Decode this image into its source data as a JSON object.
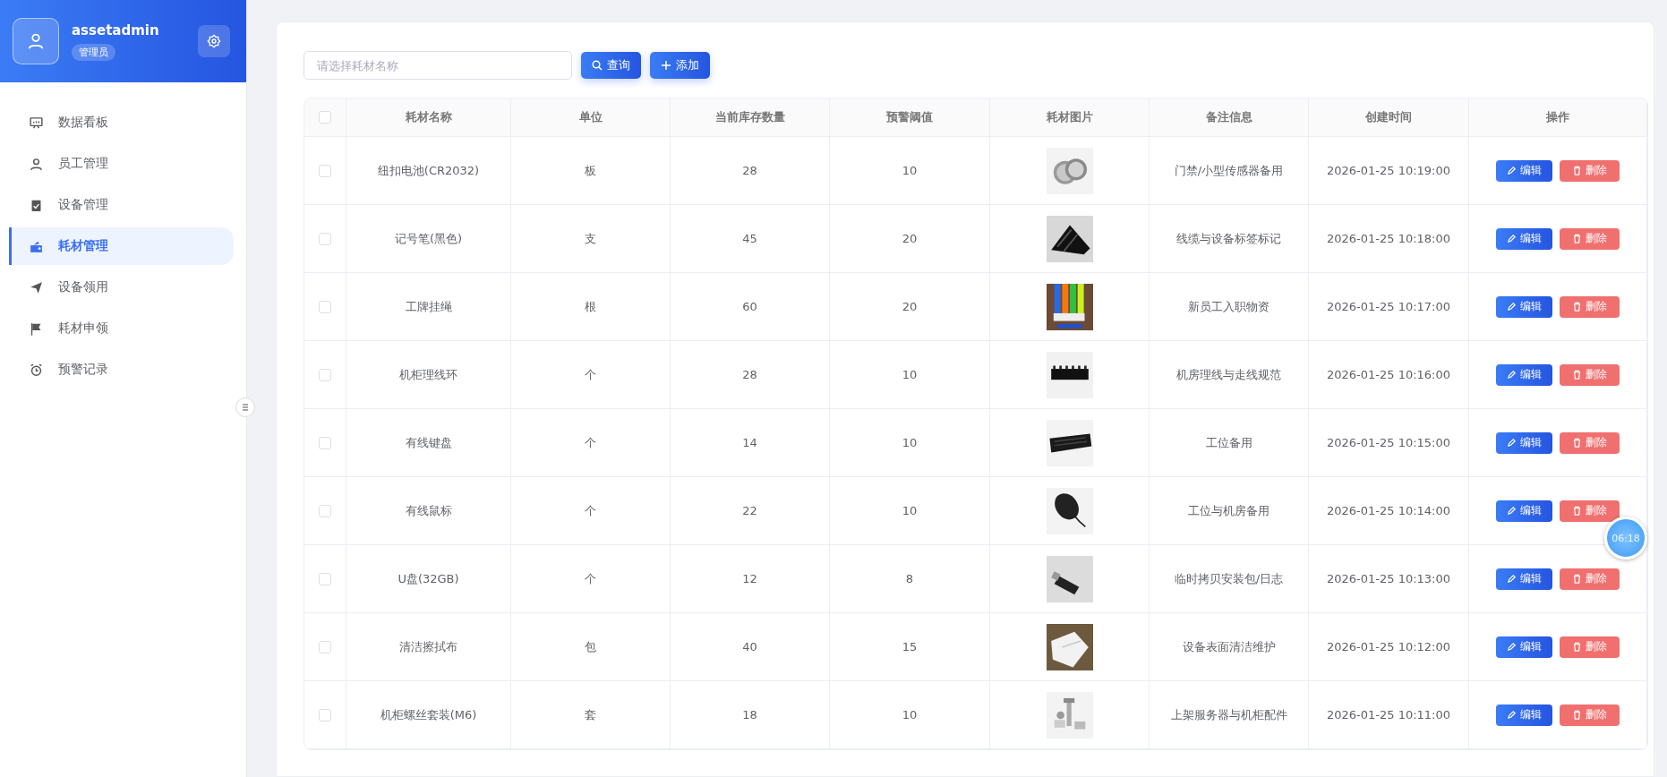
{
  "user": {
    "name": "assetadmin",
    "role": "管理员"
  },
  "nav": [
    {
      "label": "数据看板",
      "selected": false
    },
    {
      "label": "员工管理",
      "selected": false
    },
    {
      "label": "设备管理",
      "selected": false
    },
    {
      "label": "耗材管理",
      "selected": true
    },
    {
      "label": "设备领用",
      "selected": false
    },
    {
      "label": "耗材申领",
      "selected": false
    },
    {
      "label": "预警记录",
      "selected": false
    }
  ],
  "search": {
    "placeholder": "请选择耗材名称"
  },
  "buttons": [
    {
      "kind": "search",
      "label": "查询"
    },
    {
      "kind": "add",
      "label": "添加"
    }
  ],
  "table": {
    "select_all_checked": false,
    "columns": [
      "耗材名称",
      "单位",
      "当前库存数量",
      "预警阈值",
      "耗材图片",
      "备注信息",
      "创建时间",
      "操作"
    ],
    "rows": [
      {
        "checked": false,
        "name": "纽扣电池(CR2032)",
        "unit": "板",
        "stock": "28",
        "threshold": "10",
        "note": "门禁/小型传感器备用",
        "created": "2026-01-25 10:19:00",
        "edit": "编辑",
        "delete": "删除"
      },
      {
        "checked": false,
        "name": "记号笔(黑色)",
        "unit": "支",
        "stock": "45",
        "threshold": "20",
        "note": "线缆与设备标签标记",
        "created": "2026-01-25 10:18:00",
        "edit": "编辑",
        "delete": "删除"
      },
      {
        "checked": false,
        "name": "工牌挂绳",
        "unit": "根",
        "stock": "60",
        "threshold": "20",
        "note": "新员工入职物资",
        "created": "2026-01-25 10:17:00",
        "edit": "编辑",
        "delete": "删除"
      },
      {
        "checked": false,
        "name": "机柜理线环",
        "unit": "个",
        "stock": "28",
        "threshold": "10",
        "note": "机房理线与走线规范",
        "created": "2026-01-25 10:16:00",
        "edit": "编辑",
        "delete": "删除"
      },
      {
        "checked": false,
        "name": "有线键盘",
        "unit": "个",
        "stock": "14",
        "threshold": "10",
        "note": "工位备用",
        "created": "2026-01-25 10:15:00",
        "edit": "编辑",
        "delete": "删除"
      },
      {
        "checked": false,
        "name": "有线鼠标",
        "unit": "个",
        "stock": "22",
        "threshold": "10",
        "note": "工位与机房备用",
        "created": "2026-01-25 10:14:00",
        "edit": "编辑",
        "delete": "删除"
      },
      {
        "checked": false,
        "name": "U盘(32GB)",
        "unit": "个",
        "stock": "12",
        "threshold": "8",
        "note": "临时拷贝安装包/日志",
        "created": "2026-01-25 10:13:00",
        "edit": "编辑",
        "delete": "删除"
      },
      {
        "checked": false,
        "name": "清洁擦拭布",
        "unit": "包",
        "stock": "40",
        "threshold": "15",
        "note": "设备表面清洁维护",
        "created": "2026-01-25 10:12:00",
        "edit": "编辑",
        "delete": "删除"
      },
      {
        "checked": false,
        "name": "机柜螺丝套装(M6)",
        "unit": "套",
        "stock": "18",
        "threshold": "10",
        "note": "上架服务器与机柜配件",
        "created": "2026-01-25 10:11:00",
        "edit": "编辑",
        "delete": "删除"
      }
    ]
  },
  "timer": "06:18"
}
